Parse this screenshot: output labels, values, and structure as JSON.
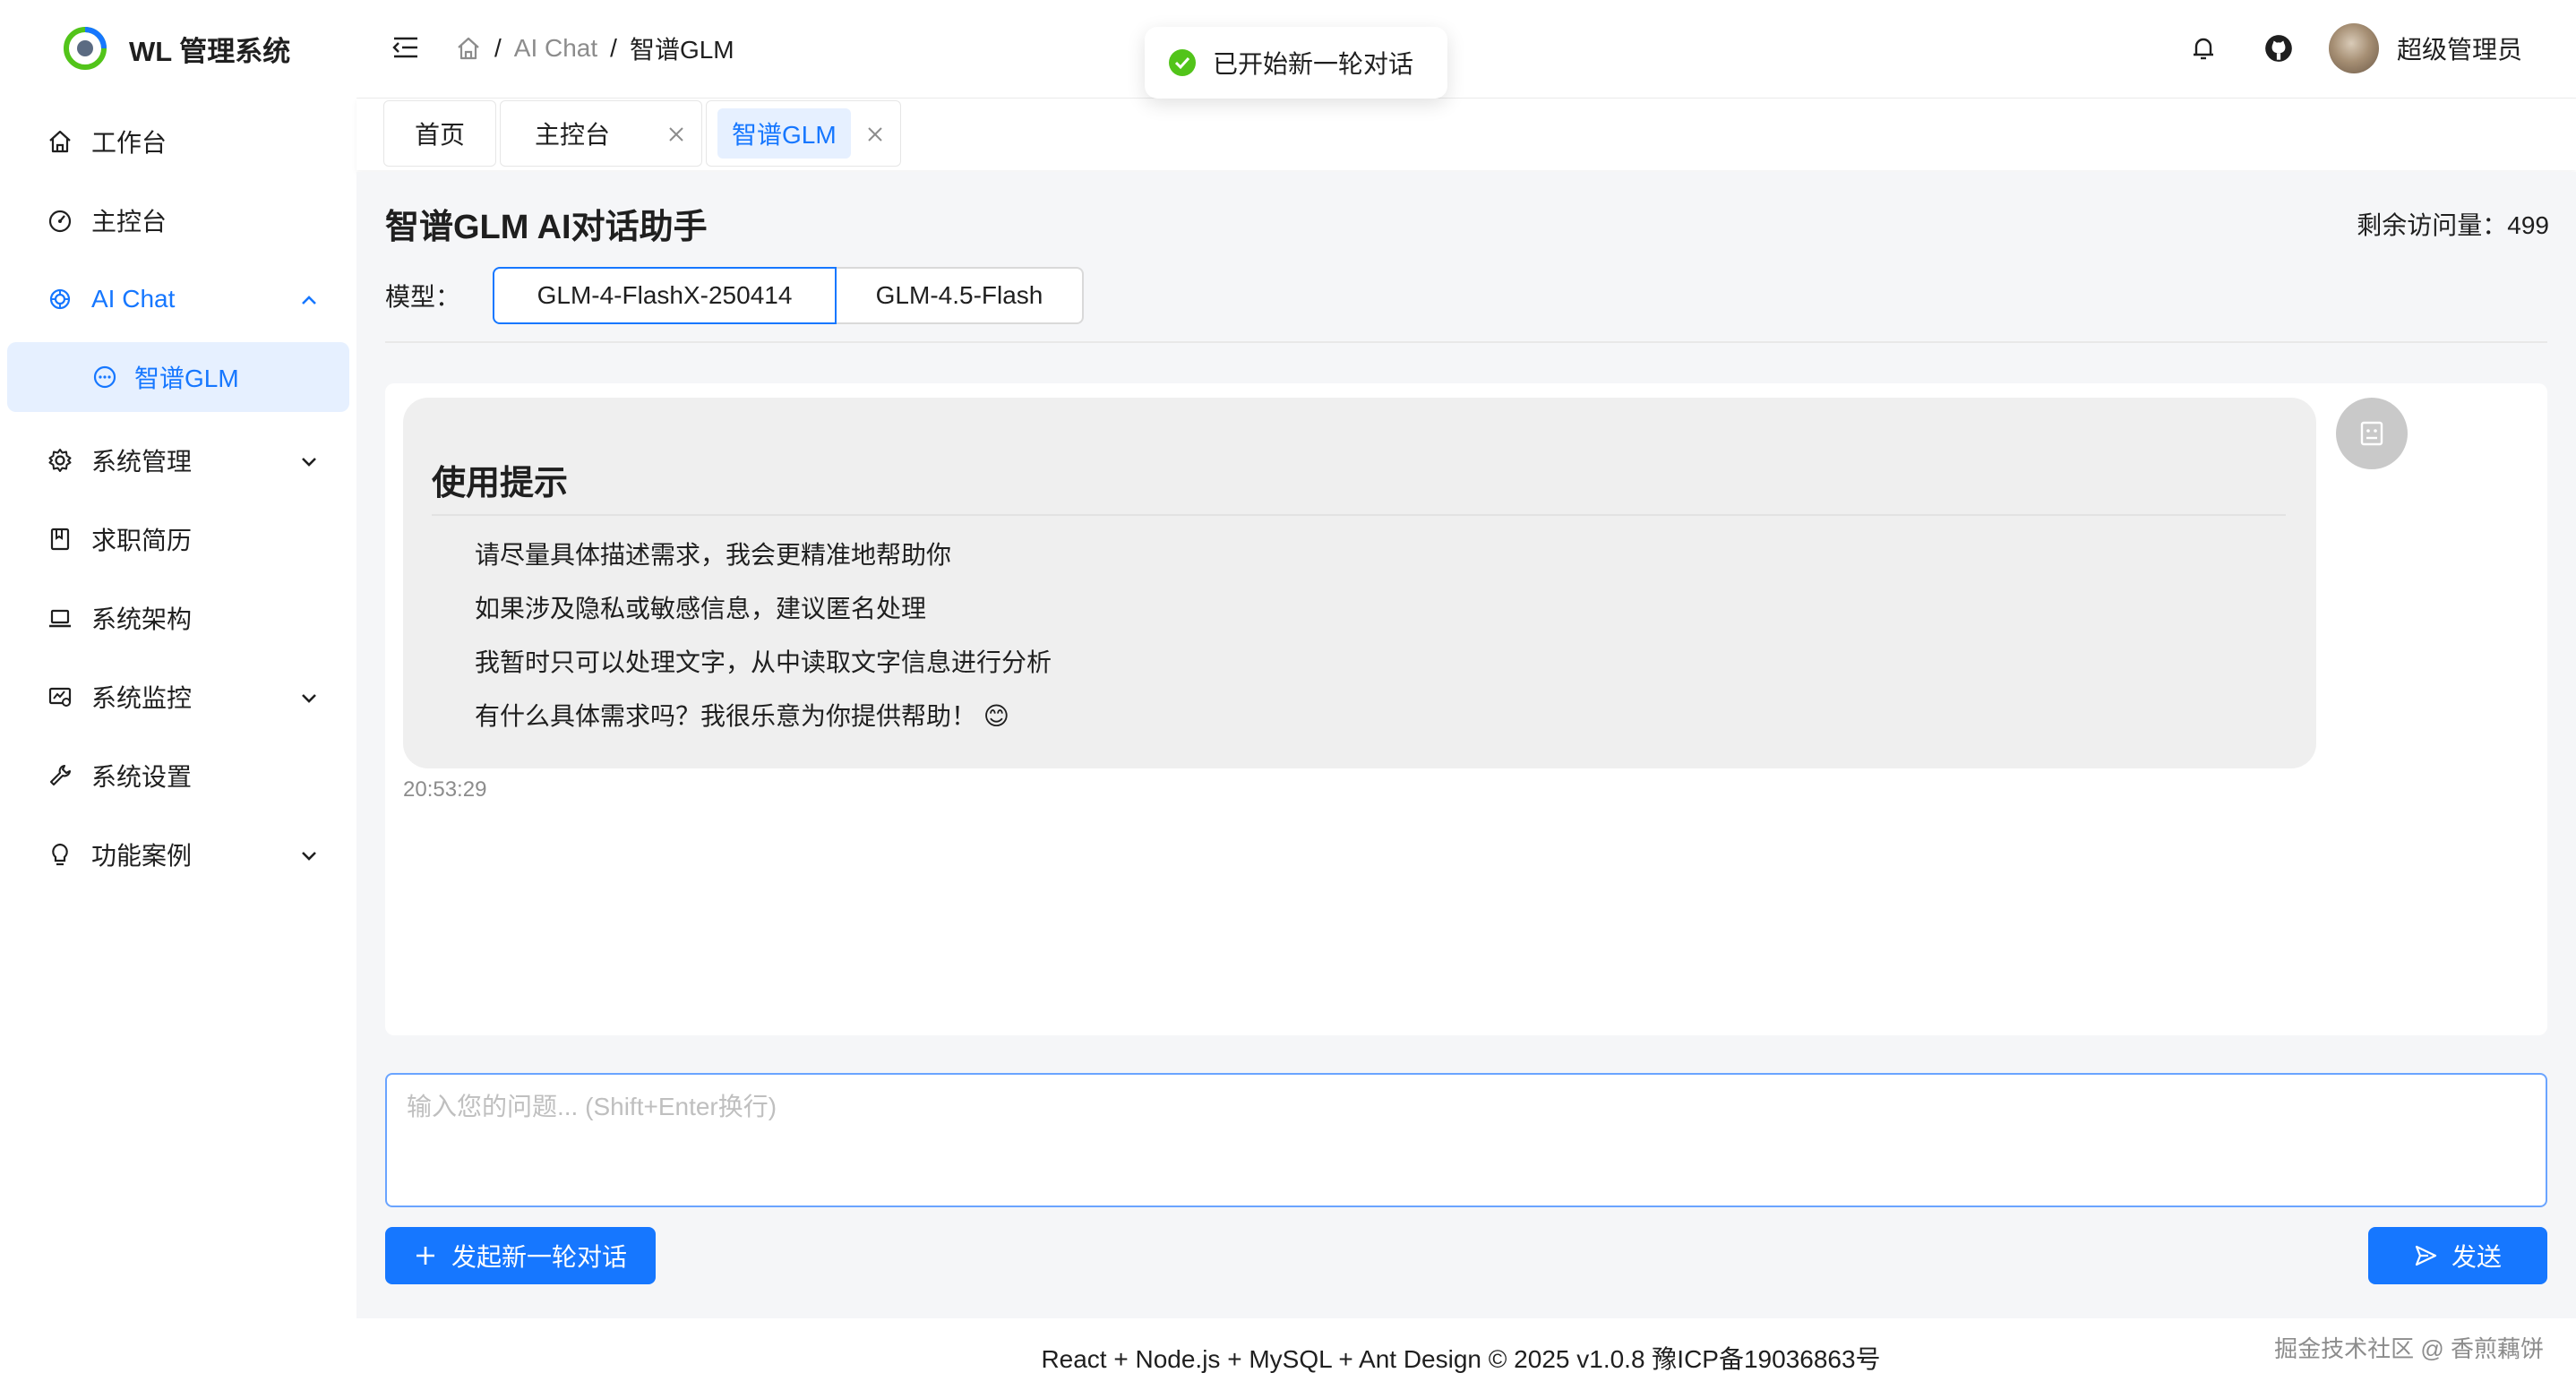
{
  "app": {
    "title": "WL 管理系统"
  },
  "sidebar": {
    "items": [
      {
        "label": "工作台",
        "icon": "home-icon"
      },
      {
        "label": "主控台",
        "icon": "dashboard-icon"
      },
      {
        "label": "AI Chat",
        "icon": "openai-icon",
        "open": true
      },
      {
        "label": "系统管理",
        "icon": "gear-icon"
      },
      {
        "label": "求职简历",
        "icon": "book-icon"
      },
      {
        "label": "系统架构",
        "icon": "laptop-icon"
      },
      {
        "label": "系统监控",
        "icon": "monitor-icon"
      },
      {
        "label": "系统设置",
        "icon": "wrench-icon"
      },
      {
        "label": "功能案例",
        "icon": "bulb-icon"
      }
    ],
    "sub_item": {
      "label": "智谱GLM",
      "icon": "chat-icon"
    }
  },
  "header": {
    "breadcrumb": [
      "AI Chat",
      "智谱GLM"
    ],
    "user_name": "超级管理员"
  },
  "toast": {
    "text": "已开始新一轮对话",
    "status": "success"
  },
  "tabs": [
    {
      "label": "首页",
      "closable": false
    },
    {
      "label": "主控台",
      "closable": true
    },
    {
      "label": "智谱GLM",
      "closable": true,
      "active": true
    }
  ],
  "page": {
    "title": "智谱GLM AI对话助手",
    "quota": "剩余访问量：499",
    "model_label": "模型：",
    "models": [
      "GLM-4-FlashX-250414",
      "GLM-4.5-Flash"
    ],
    "selected_model": "GLM-4-FlashX-250414"
  },
  "message": {
    "heading": "使用提示",
    "tips": [
      "请尽量具体描述需求，我会更精准地帮助你",
      "如果涉及隐私或敏感信息，建议匿名处理",
      "我暂时只可以处理文字，从中读取文字信息进行分析",
      "有什么具体需求吗？我很乐意为你提供帮助！ 😊"
    ],
    "time": "20:53:29"
  },
  "input": {
    "placeholder": "输入您的问题... (Shift+Enter换行)",
    "value": ""
  },
  "buttons": {
    "new_chat": "发起新一轮对话",
    "send": "发送"
  },
  "footer": {
    "text": "React + Node.js + MySQL + Ant Design © 2025 v1.0.8   豫ICP备19036863号",
    "watermark": "掘金技术社区 @ 香煎藕饼"
  },
  "colors": {
    "primary": "#1677ff",
    "success": "#52c41a",
    "content_bg": "#f5f6f8"
  }
}
